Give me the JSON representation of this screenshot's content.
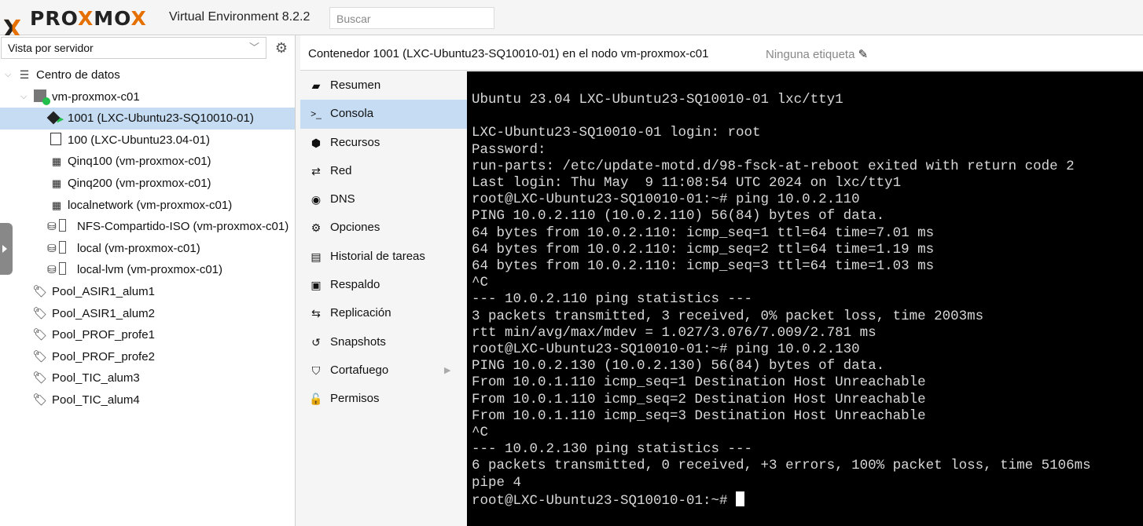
{
  "app": {
    "brand_prefix": "PRO",
    "brand_x": "X",
    "brand_mo": "MO",
    "brand_suffix": "X",
    "version": "Virtual Environment 8.2.2",
    "search_placeholder": "Buscar"
  },
  "sidebar": {
    "view_selector": "Vista por servidor",
    "tree": [
      {
        "label": "Centro de datos",
        "icon": "datacenter-icon",
        "depth": 0,
        "expanded": true
      },
      {
        "label": "vm-proxmox-c01",
        "icon": "node-online-icon",
        "depth": 1,
        "expanded": true
      },
      {
        "label": "1001 (LXC-Ubuntu23-SQ10010-01)",
        "icon": "container-running-icon",
        "depth": 2,
        "selected": true
      },
      {
        "label": "100 (LXC-Ubuntu23.04-01)",
        "icon": "container-template-icon",
        "depth": 2
      },
      {
        "label": "Qinq100 (vm-proxmox-c01)",
        "icon": "network-icon",
        "depth": 2
      },
      {
        "label": "Qinq200 (vm-proxmox-c01)",
        "icon": "network-icon",
        "depth": 2
      },
      {
        "label": "localnetwork (vm-proxmox-c01)",
        "icon": "network-icon",
        "depth": 2
      },
      {
        "label": "NFS-Compartido-ISO (vm-proxmox-c01)",
        "icon": "storage-icon",
        "depth": 2
      },
      {
        "label": "local (vm-proxmox-c01)",
        "icon": "storage-icon",
        "depth": 2
      },
      {
        "label": "local-lvm (vm-proxmox-c01)",
        "icon": "storage-icon",
        "depth": 2
      },
      {
        "label": "Pool_ASIR1_alum1",
        "icon": "tags-icon",
        "depth": 1
      },
      {
        "label": "Pool_ASIR1_alum2",
        "icon": "tags-icon",
        "depth": 1
      },
      {
        "label": "Pool_PROF_profe1",
        "icon": "tags-icon",
        "depth": 1
      },
      {
        "label": "Pool_PROF_profe2",
        "icon": "tags-icon",
        "depth": 1
      },
      {
        "label": "Pool_TIC_alum3",
        "icon": "tags-icon",
        "depth": 1
      },
      {
        "label": "Pool_TIC_alum4",
        "icon": "tags-icon",
        "depth": 1
      }
    ]
  },
  "header": {
    "title": "Contenedor 1001 (LXC-Ubuntu23-SQ10010-01) en el nodo vm-proxmox-c01",
    "tags": "Ninguna etiqueta"
  },
  "menu": [
    {
      "label": "Resumen",
      "icon": "book-icon"
    },
    {
      "label": "Consola",
      "icon": "terminal-icon",
      "active": true
    },
    {
      "label": "Recursos",
      "icon": "cube-icon"
    },
    {
      "label": "Red",
      "icon": "exchange-icon"
    },
    {
      "label": "DNS",
      "icon": "globe-icon"
    },
    {
      "label": "Opciones",
      "icon": "gear-icon"
    },
    {
      "label": "Historial de tareas",
      "icon": "list-icon"
    },
    {
      "label": "Respaldo",
      "icon": "floppy-icon"
    },
    {
      "label": "Replicación",
      "icon": "retweet-icon"
    },
    {
      "label": "Snapshots",
      "icon": "history-icon"
    },
    {
      "label": "Cortafuego",
      "icon": "shield-icon",
      "has_submenu": true
    },
    {
      "label": "Permisos",
      "icon": "unlock-icon"
    }
  ],
  "console": {
    "lines": [
      "Ubuntu 23.04 LXC-Ubuntu23-SQ10010-01 lxc/tty1",
      "",
      "LXC-Ubuntu23-SQ10010-01 login: root",
      "Password:",
      "run-parts: /etc/update-motd.d/98-fsck-at-reboot exited with return code 2",
      "Last login: Thu May  9 11:08:54 UTC 2024 on lxc/tty1",
      "root@LXC-Ubuntu23-SQ10010-01:~# ping 10.0.2.110",
      "PING 10.0.2.110 (10.0.2.110) 56(84) bytes of data.",
      "64 bytes from 10.0.2.110: icmp_seq=1 ttl=64 time=7.01 ms",
      "64 bytes from 10.0.2.110: icmp_seq=2 ttl=64 time=1.19 ms",
      "64 bytes from 10.0.2.110: icmp_seq=3 ttl=64 time=1.03 ms",
      "^C",
      "--- 10.0.2.110 ping statistics ---",
      "3 packets transmitted, 3 received, 0% packet loss, time 2003ms",
      "rtt min/avg/max/mdev = 1.027/3.076/7.009/2.781 ms",
      "root@LXC-Ubuntu23-SQ10010-01:~# ping 10.0.2.130",
      "PING 10.0.2.130 (10.0.2.130) 56(84) bytes of data.",
      "From 10.0.1.110 icmp_seq=1 Destination Host Unreachable",
      "From 10.0.1.110 icmp_seq=2 Destination Host Unreachable",
      "From 10.0.1.110 icmp_seq=3 Destination Host Unreachable",
      "^C",
      "--- 10.0.2.130 ping statistics ---",
      "6 packets transmitted, 0 received, +3 errors, 100% packet loss, time 5106ms",
      "pipe 4"
    ],
    "prompt": "root@LXC-Ubuntu23-SQ10010-01:~# "
  },
  "colors": {
    "brand_orange": "#e57000",
    "selected_bg": "#c5dcf2",
    "console_bg": "#000000"
  }
}
